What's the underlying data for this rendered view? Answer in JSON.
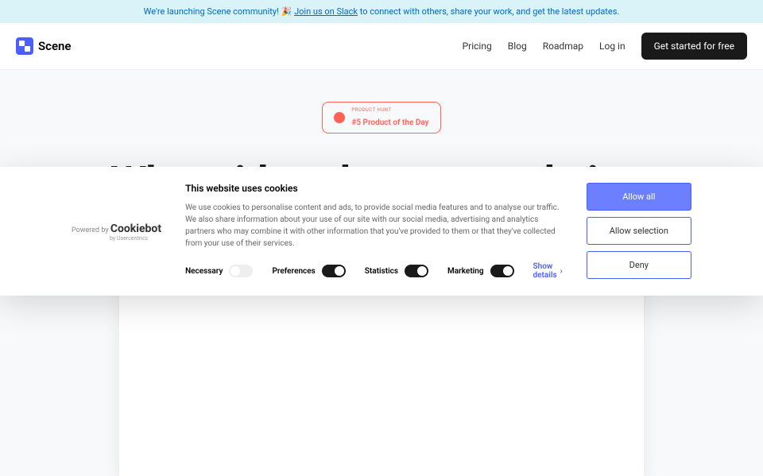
{
  "announce": {
    "prefix": "We're launching Scene community! 🎉 ",
    "link": "Join us on Slack",
    "suffix": " to connect with others, share your work, and get the latest updates."
  },
  "brand": "Scene",
  "nav": {
    "pricing": "Pricing",
    "blog": "Blog",
    "roadmap": "Roadmap",
    "login": "Log in",
    "cta": "Get started for free"
  },
  "badge": {
    "tag": "PRODUCT HUNT",
    "title": "#5 Product of the Day"
  },
  "hero": {
    "title": "Where ideas become websites"
  },
  "cookie": {
    "powered": "Powered by",
    "brand": "Cookiebot",
    "sub": "by Usercentrics",
    "title": "This website uses cookies",
    "desc": "We use cookies to personalise content and ads, to provide social media features and to analyse our traffic. We also share information about your use of our site with our social media, advertising and analytics partners who may combine it with other information that you've provided to them or that they've collected from your use of their services.",
    "necessary": "Necessary",
    "preferences": "Preferences",
    "statistics": "Statistics",
    "marketing": "Marketing",
    "details": "Show details",
    "allowAll": "Allow all",
    "allowSel": "Allow selection",
    "deny": "Deny"
  }
}
